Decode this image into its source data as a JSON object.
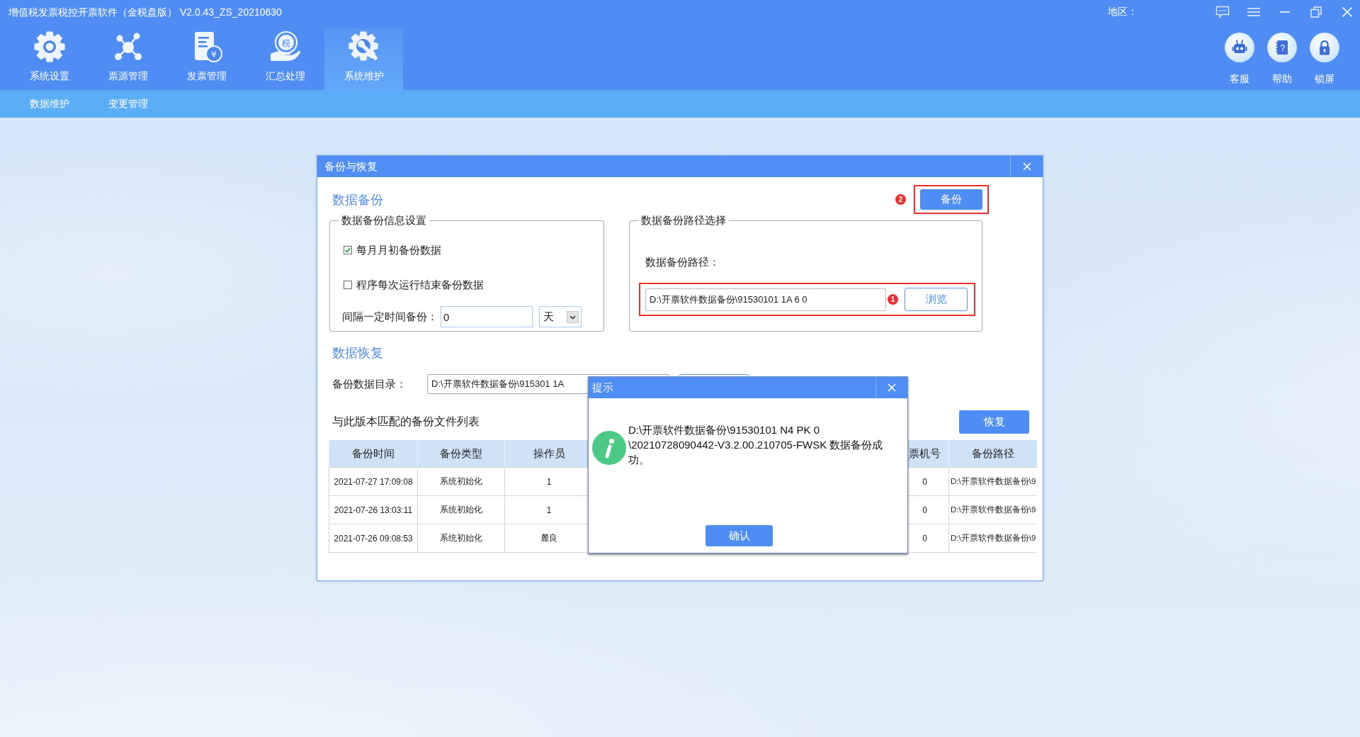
{
  "window": {
    "title": "增值税发票税控开票软件（金税盘版） V2.0.43_ZS_20210630",
    "region_label": "地区："
  },
  "nav": [
    {
      "label": "系统设置",
      "selected": false
    },
    {
      "label": "票源管理",
      "selected": false
    },
    {
      "label": "发票管理",
      "selected": false,
      "icon_text": "¥"
    },
    {
      "label": "汇总处理",
      "selected": false,
      "icon_text": "税"
    },
    {
      "label": "系统维护",
      "selected": true
    }
  ],
  "tools": [
    {
      "label": "客服"
    },
    {
      "label": "帮助",
      "icon_text": "?"
    },
    {
      "label": "锁屏"
    }
  ],
  "subnav": [
    {
      "label": "数据维护"
    },
    {
      "label": "变更管理"
    }
  ],
  "dialog": {
    "title": "备份与恢复",
    "backup": {
      "heading": "数据备份",
      "button": {
        "label": "备份",
        "step": "2",
        "highlighted": true
      },
      "settings": {
        "legend": "数据备份信息设置",
        "options": [
          {
            "label": "每月月初备份数据",
            "checked": true
          },
          {
            "label": "程序每次运行结束备份数据",
            "checked": false
          }
        ],
        "interval": {
          "label": "间隔一定时间备份：",
          "value": "0",
          "unit": "天"
        }
      },
      "path": {
        "legend": "数据备份路径选择",
        "label": "数据备份路径：",
        "value": "D:\\开票软件数据备份\\91530101 1A 6 0",
        "step": "1",
        "highlighted": true,
        "browse_button": "浏览"
      }
    },
    "restore": {
      "heading": "数据恢复",
      "directory": {
        "label": "备份数据目录：",
        "value": "D:\\开票软件数据备份\\915301 1A"
      },
      "list_title": "与此版本匹配的备份文件列表",
      "button": "恢复",
      "table": {
        "columns": [
          "备份时间",
          "备份类型",
          "操作员",
          "票机号",
          "备份路径"
        ],
        "rows": [
          [
            "2021-07-27 17:09:08",
            "系统初始化",
            "1",
            "0",
            "D:\\开票软件数据备份\\9"
          ],
          [
            "2021-07-26 13:03:11",
            "系统初始化",
            "1",
            "0",
            "D:\\开票软件数据备份\\9"
          ],
          [
            "2021-07-26 09:08:53",
            "系统初始化",
            "麓良",
            "0",
            "D:\\开票软件数据备份\\9"
          ]
        ]
      }
    }
  },
  "popup": {
    "title": "提示",
    "message": "D:\\开票软件数据备份\\91530101 N4 PK 0\n\\20210728090442-V3.2.00.210705-FWSK 数据备份成功。",
    "button": "确认"
  }
}
